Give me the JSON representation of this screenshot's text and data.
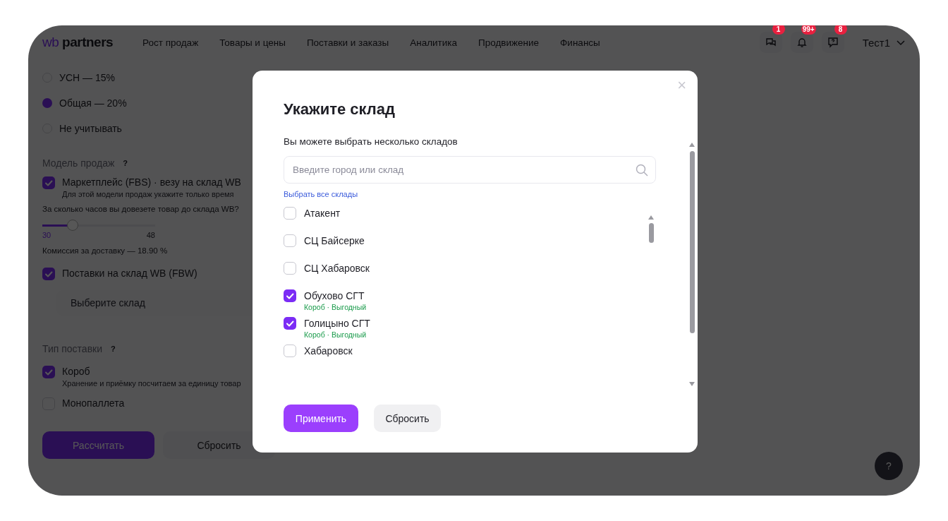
{
  "header": {
    "logo": {
      "prefix": "wb",
      "name": "partners"
    },
    "nav": [
      "Рост продаж",
      "Товары и цены",
      "Поставки и заказы",
      "Аналитика",
      "Продвижение",
      "Финансы"
    ],
    "icons": [
      {
        "kind": "chat",
        "badge": "1"
      },
      {
        "kind": "bell",
        "badge": "99+"
      },
      {
        "kind": "help",
        "badge": "8"
      }
    ],
    "user": "Тест1"
  },
  "form": {
    "tax_options": [
      {
        "label": "УСН — 15%",
        "selected": false
      },
      {
        "label": "Общая — 20%",
        "selected": true
      },
      {
        "label": "Не учитывать",
        "selected": false
      }
    ],
    "sales_model": {
      "label": "Модель продаж",
      "hint": "?"
    },
    "fbs": {
      "label": "Маркетплейс (FBS) · везу на склад WB",
      "checked": true,
      "note": "Для этой модели продаж укажите только время"
    },
    "delivery_question": "За сколько часов вы довезете товар до склада WB?",
    "slider": {
      "level": 0.27,
      "min": "30",
      "max": "48"
    },
    "commission": "Комиссия за доставку — 18.90 %",
    "fbw": {
      "label": "Поставки на склад WB (FBW)",
      "checked": true
    },
    "warehouse_select": {
      "placeholder": "Выберите склад"
    },
    "supply_type": {
      "label": "Тип поставки",
      "hint": "?"
    },
    "supply_options": [
      {
        "label": "Короб",
        "checked": true,
        "note": "Хранение и приёмку посчитаем за единицу товар"
      },
      {
        "label": "Монопаллета",
        "checked": false
      }
    ],
    "buttons": [
      {
        "label": "Рассчитать",
        "kind": "primary"
      },
      {
        "label": "Сбросить",
        "kind": "secondary"
      }
    ]
  },
  "help_button": "?",
  "modal": {
    "close": "×",
    "title": "Укажите склад",
    "subtitle": "Вы можете выбрать несколько складов",
    "search": {
      "placeholder": "Введите город или склад"
    },
    "select_all": "Выбрать все склады",
    "warehouses": [
      {
        "name": "Атакент",
        "checked": false
      },
      {
        "name": "СЦ Байсерке",
        "checked": false
      },
      {
        "name": "СЦ Хабаровск",
        "checked": false
      },
      {
        "name": "Обухово СГТ",
        "checked": true,
        "tag": "Короб · Выгодный"
      },
      {
        "name": "Голицыно СГТ",
        "checked": true,
        "tag": "Короб · Выгодный"
      },
      {
        "name": "Хабаровск",
        "checked": false
      }
    ],
    "buttons": [
      {
        "label": "Применить",
        "kind": "primary"
      },
      {
        "label": "Сбросить",
        "kind": "secondary"
      }
    ]
  }
}
